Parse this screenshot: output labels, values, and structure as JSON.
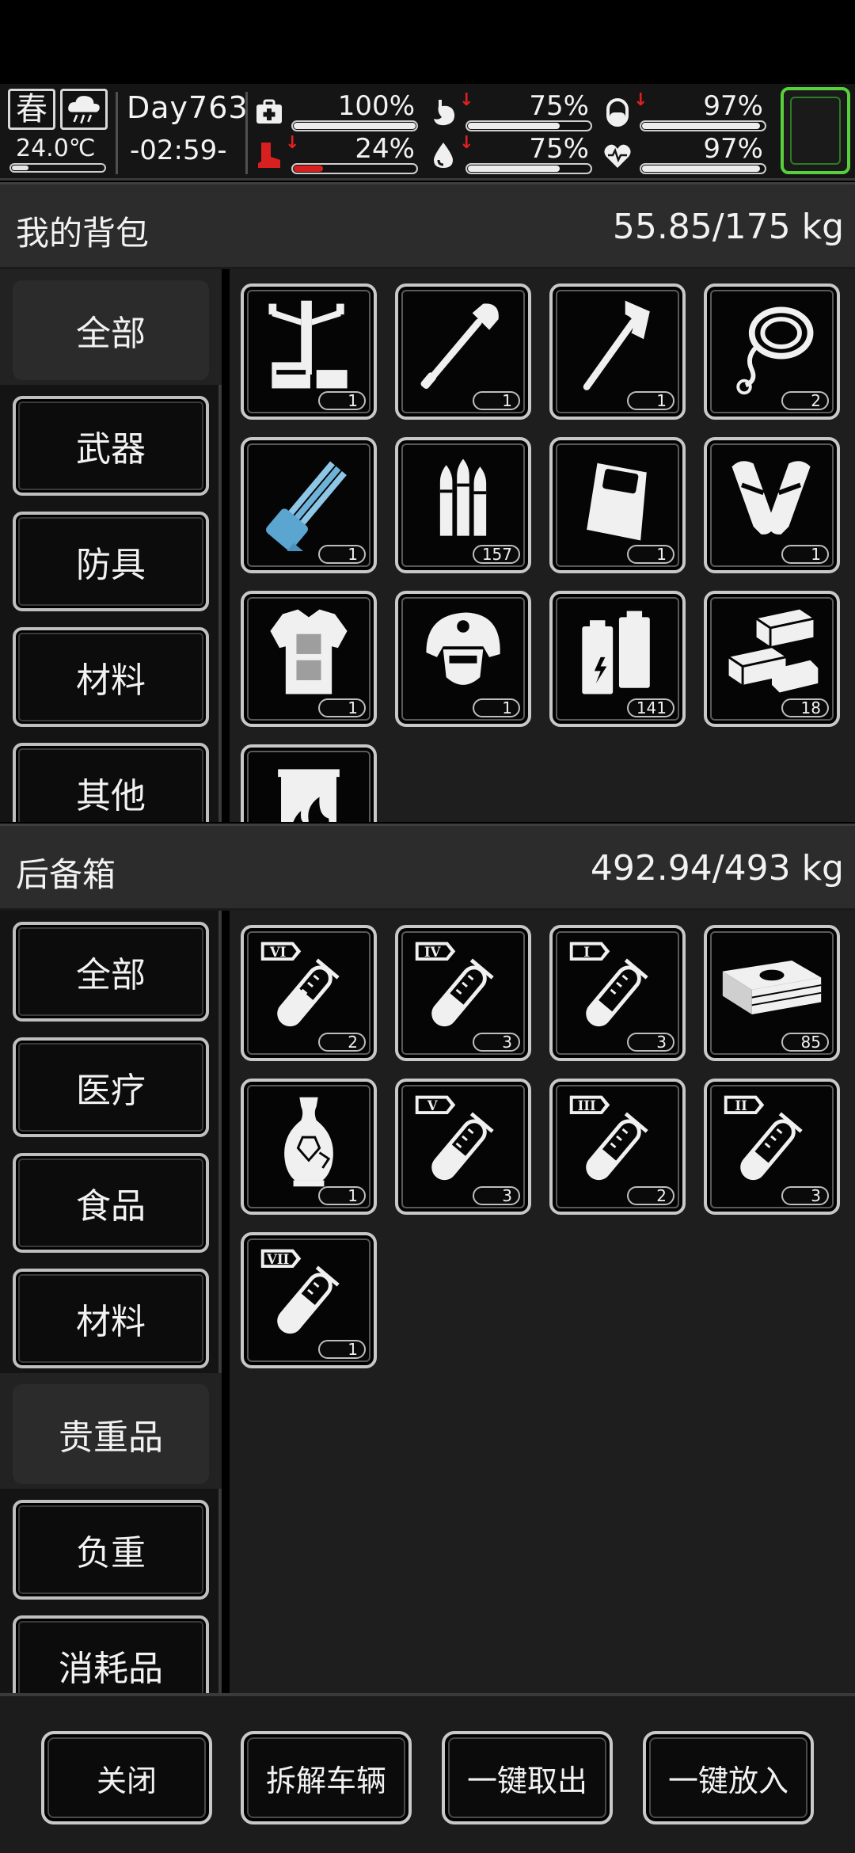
{
  "status": {
    "season": "春",
    "temperature": "24.0℃",
    "temperature_level": 0.18,
    "day": "Day763",
    "time": "-02:59-",
    "stats": [
      {
        "icon": "medkit-icon",
        "value": "100%",
        "level": 1.0,
        "down": false,
        "critical": false
      },
      {
        "icon": "stomach-icon",
        "value": "75%",
        "level": 0.75,
        "down": true,
        "critical": false
      },
      {
        "icon": "pill-icon",
        "value": "97%",
        "level": 0.97,
        "down": true,
        "critical": false
      },
      {
        "icon": "boot-icon",
        "value": "24%",
        "level": 0.24,
        "down": true,
        "critical": true
      },
      {
        "icon": "water-drop-icon",
        "value": "75%",
        "level": 0.75,
        "down": true,
        "critical": false
      },
      {
        "icon": "heart-icon",
        "value": "97%",
        "level": 0.97,
        "down": false,
        "critical": false
      }
    ],
    "arrow": "↓"
  },
  "backpack": {
    "title": "我的背包",
    "weight": "55.85/175 kg",
    "tabs": [
      "全部",
      "武器",
      "防具",
      "材料",
      "其他"
    ],
    "active_tab": 0,
    "items": [
      {
        "icon": "workbench-icon",
        "qty": "1"
      },
      {
        "icon": "shovel-icon",
        "qty": "1"
      },
      {
        "icon": "axe-icon",
        "qty": "1"
      },
      {
        "icon": "rope-icon",
        "qty": "2"
      },
      {
        "icon": "minigun-icon",
        "qty": "1"
      },
      {
        "icon": "bullets-icon",
        "qty": "157"
      },
      {
        "icon": "backpack-icon",
        "qty": "1"
      },
      {
        "icon": "shin-guards-icon",
        "qty": "1"
      },
      {
        "icon": "body-armor-icon",
        "qty": "1"
      },
      {
        "icon": "helmet-icon",
        "qty": "1"
      },
      {
        "icon": "battery-icon",
        "qty": "141"
      },
      {
        "icon": "bricks-icon",
        "qty": "18"
      },
      {
        "icon": "fire-barrel-icon",
        "qty": ""
      }
    ]
  },
  "trunk": {
    "title": "后备箱",
    "weight": "492.94/493 kg",
    "tabs": [
      "全部",
      "医疗",
      "食品",
      "材料",
      "贵重品",
      "负重",
      "消耗品"
    ],
    "active_tab": 4,
    "items": [
      {
        "icon": "test-tube-icon",
        "tier": "VI",
        "fill": 0.55,
        "qty": "2"
      },
      {
        "icon": "test-tube-icon",
        "tier": "IV",
        "fill": 0.45,
        "qty": "3"
      },
      {
        "icon": "test-tube-icon",
        "tier": "I",
        "fill": 0.3,
        "qty": "3"
      },
      {
        "icon": "cash-stack-icon",
        "qty": "85"
      },
      {
        "icon": "vase-icon",
        "qty": "1"
      },
      {
        "icon": "test-tube-icon",
        "tier": "V",
        "fill": 0.5,
        "qty": "3"
      },
      {
        "icon": "test-tube-icon",
        "tier": "III",
        "fill": 0.4,
        "qty": "2"
      },
      {
        "icon": "test-tube-icon",
        "tier": "II",
        "fill": 0.35,
        "qty": "3"
      },
      {
        "icon": "test-tube-icon",
        "tier": "VII",
        "fill": 0.6,
        "qty": "1"
      }
    ]
  },
  "buttons": {
    "close": "关闭",
    "dismantle": "拆解车辆",
    "take_all": "一键取出",
    "put_all": "一键放入"
  }
}
